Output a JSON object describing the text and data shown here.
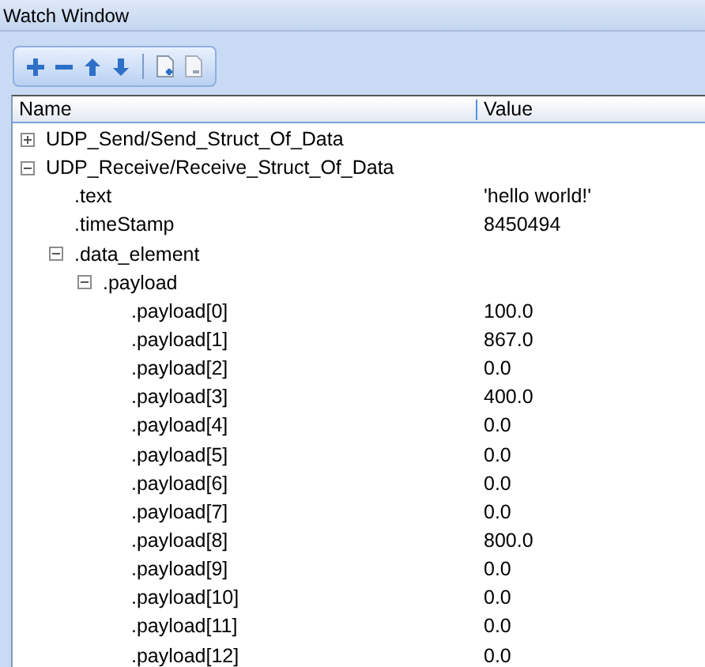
{
  "window": {
    "title": "Watch Window"
  },
  "columns": [
    "Name",
    "Value"
  ],
  "tree": [
    {
      "name": "UDP_Send/Send_Struct_Of_Data",
      "expanded": false
    },
    {
      "name": "UDP_Receive/Receive_Struct_Of_Data",
      "expanded": true,
      "children": [
        {
          "name": ".text",
          "value": "'hello world!'"
        },
        {
          "name": ".timeStamp",
          "value": "8450494"
        },
        {
          "name": ".data_element",
          "expanded": true,
          "children": [
            {
              "name": ".payload",
              "expanded": true,
              "children": [
                {
                  "name": ".payload[0]",
                  "value": "100.0"
                },
                {
                  "name": ".payload[1]",
                  "value": "867.0"
                },
                {
                  "name": ".payload[2]",
                  "value": "0.0"
                },
                {
                  "name": ".payload[3]",
                  "value": "400.0"
                },
                {
                  "name": ".payload[4]",
                  "value": "0.0"
                },
                {
                  "name": ".payload[5]",
                  "value": "0.0"
                },
                {
                  "name": ".payload[6]",
                  "value": "0.0"
                },
                {
                  "name": ".payload[7]",
                  "value": "0.0"
                },
                {
                  "name": ".payload[8]",
                  "value": "800.0"
                },
                {
                  "name": ".payload[9]",
                  "value": "0.0"
                },
                {
                  "name": ".payload[10]",
                  "value": "0.0"
                },
                {
                  "name": ".payload[11]",
                  "value": "0.0"
                },
                {
                  "name": ".payload[12]",
                  "value": "0.0"
                }
              ]
            }
          ]
        }
      ]
    }
  ]
}
